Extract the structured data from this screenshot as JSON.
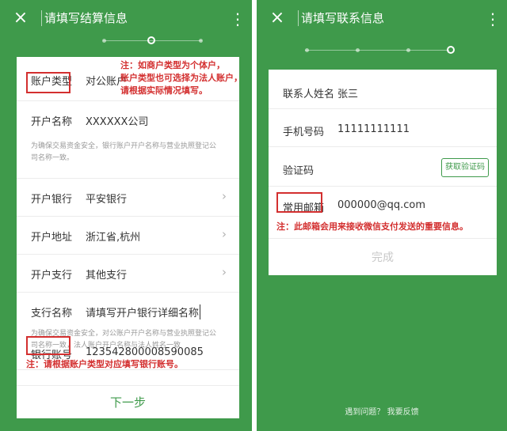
{
  "left": {
    "title": "请填写结算信息",
    "close_icon": "×",
    "more_icon": "⋮",
    "rows": {
      "account_type": {
        "label": "账户类型",
        "value": "对公账户"
      },
      "account_name": {
        "label": "开户名称",
        "value": "XXXXXX公司"
      },
      "bank": {
        "label": "开户银行",
        "value": "平安银行"
      },
      "bank_location": {
        "label": "开户地址",
        "value": "浙江省,杭州"
      },
      "branch": {
        "label": "开户支行",
        "value": "其他支行"
      },
      "branch_name": {
        "label": "支行名称",
        "value": "请填写开户银行详细名称"
      },
      "account_number": {
        "label": "银行账号",
        "value": "123542800008590085"
      }
    },
    "hint1_line1": "为确保交易资金安全，银行账户开户名称与营业执照登记公",
    "hint1_line2": "司名称一致。",
    "hint2_line1": "为确保交易资金安全，对公账户开户名称与营业执照登记公",
    "hint2_line2": "司名称一致，法人账户开户名称与法人姓名一致",
    "note_top_line1": "注：如商户类型为个体户，",
    "note_top_line2": "账户类型也可选择为法人账户，",
    "note_top_line3": "请根据实际情况填写。",
    "note_bottom": "注：请根据账户类型对应填写银行账号。",
    "next_button": "下一步",
    "chevron_icon": "›"
  },
  "right": {
    "title": "请填写联系信息",
    "close_icon": "×",
    "more_icon": "⋮",
    "rows": {
      "contact_name": {
        "label": "联系人姓名",
        "value": "张三"
      },
      "phone": {
        "label": "手机号码",
        "value": "11111111111"
      },
      "code": {
        "label": "验证码",
        "button": "获取验证码"
      },
      "email": {
        "label": "常用邮箱",
        "value": "000000@qq.com"
      }
    },
    "note_email": "注：此邮箱会用来接收微信支付发送的重要信息。",
    "done_button": "完成",
    "footer_text": "遇到问题？ 我要反馈"
  },
  "colors": {
    "brand_green": "#3f9a4b",
    "annotation_red": "#d32f2f"
  }
}
